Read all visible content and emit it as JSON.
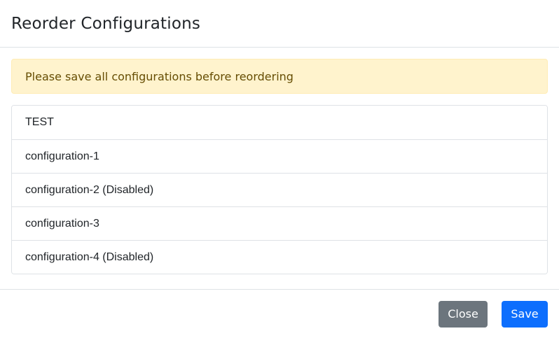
{
  "modal": {
    "title": "Reorder Configurations"
  },
  "alert": {
    "message": "Please save all configurations before reordering"
  },
  "configurations": [
    {
      "label": "TEST"
    },
    {
      "label": "configuration-1"
    },
    {
      "label": "configuration-2 (Disabled)"
    },
    {
      "label": "configuration-3"
    },
    {
      "label": "configuration-4 (Disabled)"
    }
  ],
  "footer": {
    "close_label": "Close",
    "save_label": "Save"
  },
  "colors": {
    "alert_background": "#fff3cd",
    "alert_text": "#664d03",
    "close_button": "#6c757d",
    "save_button": "#0d6efd"
  }
}
